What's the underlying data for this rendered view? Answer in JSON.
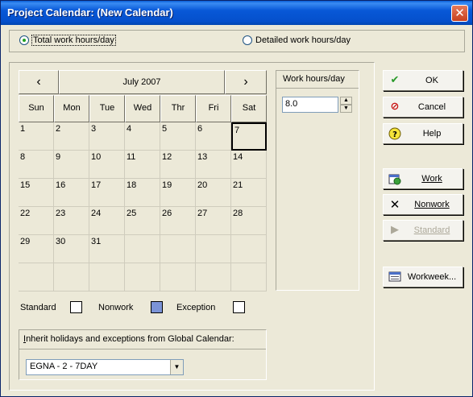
{
  "window": {
    "title": "Project Calendar: (New Calendar)",
    "close_glyph": "✕"
  },
  "mode": {
    "total_label": "Total work hours/day",
    "detailed_label": "Detailed work hours/day",
    "selected": "total"
  },
  "calendar": {
    "month_label": "July 2007",
    "prev_glyph": "‹",
    "next_glyph": "›",
    "weekdays": [
      "Sun",
      "Mon",
      "Tue",
      "Wed",
      "Thr",
      "Fri",
      "Sat"
    ],
    "weeks": [
      [
        "1",
        "2",
        "3",
        "4",
        "5",
        "6",
        "7"
      ],
      [
        "8",
        "9",
        "10",
        "11",
        "12",
        "13",
        "14"
      ],
      [
        "15",
        "16",
        "17",
        "18",
        "19",
        "20",
        "21"
      ],
      [
        "22",
        "23",
        "24",
        "25",
        "26",
        "27",
        "28"
      ],
      [
        "29",
        "30",
        "31",
        "",
        "",
        "",
        ""
      ],
      [
        "",
        "",
        "",
        "",
        "",
        "",
        ""
      ]
    ],
    "selected_day": "7"
  },
  "work_hours": {
    "header": "Work hours/day",
    "value": "8.0"
  },
  "legend": {
    "standard": "Standard",
    "nonwork": "Nonwork",
    "exception": "Exception",
    "colors": {
      "standard": "#ffffff",
      "nonwork": "#7b93d6",
      "exception": "#ffffff"
    }
  },
  "inherit": {
    "label_prefix": "I",
    "label_rest": "nherit holidays and exceptions from Global Calendar:",
    "selected_value": "EGNA - 2 - 7DAY"
  },
  "buttons": {
    "ok": "OK",
    "cancel": "Cancel",
    "help": "Help",
    "work": "Work",
    "nonwork": "Nonwork",
    "standard": "Standard",
    "workweek": "Workweek..."
  }
}
